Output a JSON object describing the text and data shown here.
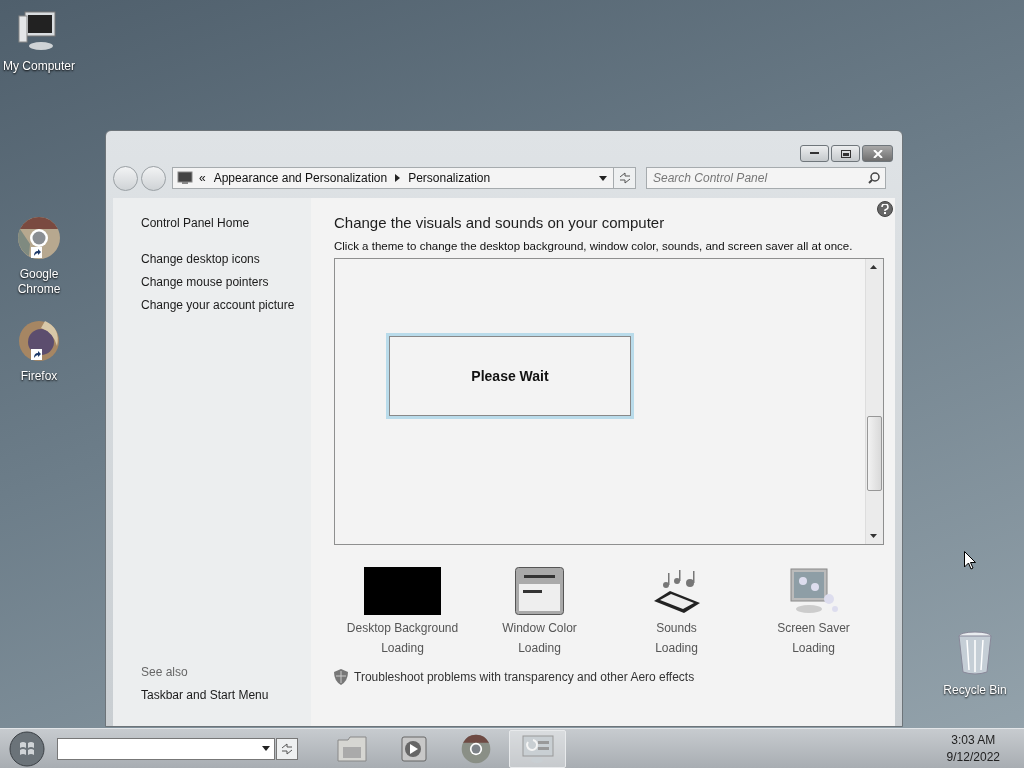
{
  "desktop_icons": [
    {
      "label": "My Computer",
      "kind": "computer",
      "shortcut": false
    },
    {
      "label": "Google Chrome",
      "kind": "chrome",
      "shortcut": true
    },
    {
      "label": "Firefox",
      "kind": "firefox",
      "shortcut": true
    },
    {
      "label": "Recycle Bin",
      "kind": "recycle",
      "shortcut": false
    }
  ],
  "window": {
    "address": {
      "prefix": "«",
      "crumbs": [
        "Appearance and Personalization",
        "Personalization"
      ]
    },
    "search": {
      "placeholder": "Search Control Panel"
    },
    "sidebar": {
      "home": "Control Panel Home",
      "tasks": [
        "Change desktop icons",
        "Change mouse pointers",
        "Change your account picture"
      ],
      "see_also": {
        "heading": "See also",
        "links": [
          "Taskbar and Start Menu"
        ]
      }
    },
    "main": {
      "title": "Change the visuals and sounds on your computer",
      "description": "Click a theme to change the desktop background, window color, sounds, and screen saver all at once.",
      "theme_list": {
        "message": "Please Wait"
      },
      "settings": [
        {
          "kind": "background",
          "label": "Desktop Background",
          "status": "Loading"
        },
        {
          "kind": "color",
          "label": "Window Color",
          "status": "Loading"
        },
        {
          "kind": "sounds",
          "label": "Sounds",
          "status": "Loading"
        },
        {
          "kind": "screensaver",
          "label": "Screen Saver",
          "status": "Loading"
        }
      ],
      "troubleshoot": "Troubleshoot problems with transparency and other Aero effects"
    }
  },
  "taskbar": {
    "items": [
      {
        "kind": "explorer",
        "selected": false
      },
      {
        "kind": "media",
        "selected": false
      },
      {
        "kind": "chrome",
        "selected": false
      },
      {
        "kind": "control-panel",
        "selected": true
      }
    ],
    "clock": {
      "time": "3:03 AM",
      "date": "9/12/2022"
    }
  }
}
